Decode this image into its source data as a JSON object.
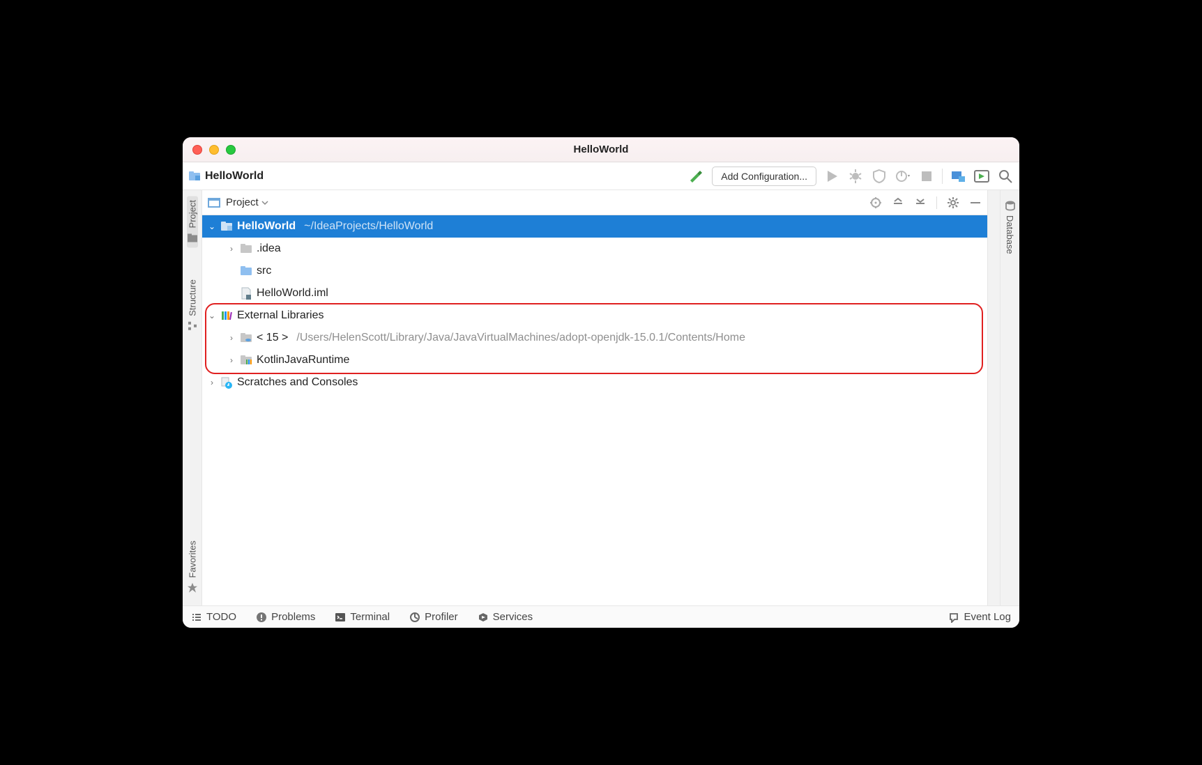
{
  "window_title": "HelloWorld",
  "breadcrumb": {
    "project_name": "HelloWorld"
  },
  "toolbar": {
    "add_config_label": "Add Configuration..."
  },
  "left_sidebar": {
    "tabs": [
      "Project",
      "Structure",
      "Favorites"
    ]
  },
  "right_sidebar": {
    "tabs": [
      "Database"
    ]
  },
  "tool_window": {
    "title": "Project"
  },
  "tree": {
    "root": {
      "name": "HelloWorld",
      "path": "~/IdeaProjects/HelloWorld"
    },
    "idea_folder": ".idea",
    "src_folder": "src",
    "iml_file": "HelloWorld.iml",
    "ext_lib_label": "External Libraries",
    "jdk": {
      "name": "< 15 >",
      "path": "/Users/HelenScott/Library/Java/JavaVirtualMachines/adopt-openjdk-15.0.1/Contents/Home"
    },
    "kotlin_runtime": "KotlinJavaRuntime",
    "scratches": "Scratches and Consoles"
  },
  "statusbar": {
    "todo": "TODO",
    "problems": "Problems",
    "terminal": "Terminal",
    "profiler": "Profiler",
    "services": "Services",
    "event_log": "Event Log"
  }
}
